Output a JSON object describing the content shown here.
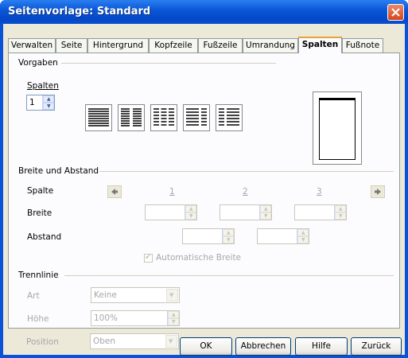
{
  "window": {
    "title": "Seitenvorlage: Standard"
  },
  "tabs": [
    {
      "label": "Verwalten"
    },
    {
      "label": "Seite"
    },
    {
      "label": "Hintergrund"
    },
    {
      "label": "Kopfzeile"
    },
    {
      "label": "Fußzeile"
    },
    {
      "label": "Umrandung"
    },
    {
      "label": "Spalten",
      "active": true
    },
    {
      "label": "Fußnote"
    }
  ],
  "vorgaben": {
    "legend": "Vorgaben",
    "spalten_label": "Spalten",
    "spalten_value": "1",
    "presets": [
      "1 Spalte",
      "2 Spalten",
      "3 Spalten",
      "2 Spalten links breiter",
      "2 Spalten rechts breiter"
    ]
  },
  "breite": {
    "legend": "Breite und Abstand",
    "spalte_label": "Spalte",
    "breite_label": "Breite",
    "abstand_label": "Abstand",
    "col_numbers": [
      "1",
      "2",
      "3"
    ],
    "auto_width_label": "Automatische Breite",
    "auto_width_checked": true
  },
  "trennlinie": {
    "legend": "Trennlinie",
    "art_label": "Art",
    "art_value": "Keine",
    "hoehe_label": "Höhe",
    "hoehe_value": "100%",
    "position_label": "Position",
    "position_value": "Oben"
  },
  "buttons": {
    "ok": "OK",
    "cancel": "Abbrechen",
    "help": "Hilfe",
    "back": "Zurück"
  },
  "colors": {
    "titlebar": "#0a52d6",
    "dialog_bg": "#ece9d8",
    "active_tab_accent": "#e6a33b",
    "disabled_text": "#a7a6aa"
  }
}
